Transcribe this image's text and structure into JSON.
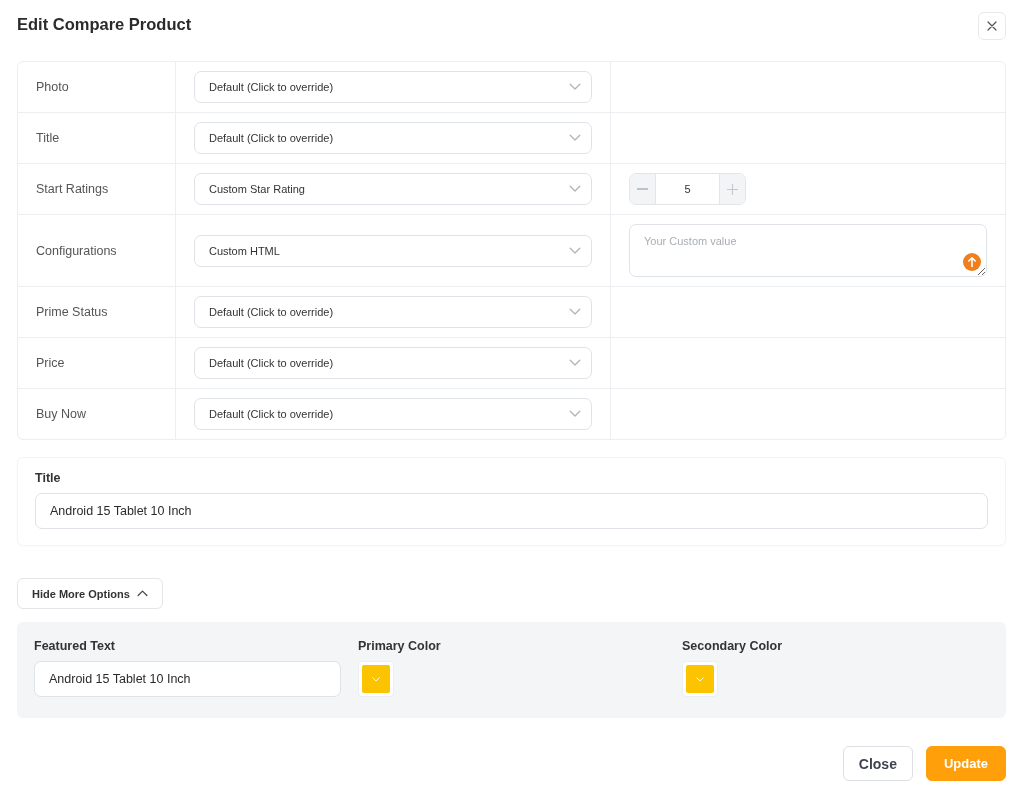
{
  "dialog": {
    "title": "Edit Compare Product"
  },
  "fields": [
    {
      "label": "Photo",
      "select": "Default (Click to override)",
      "kind": "none"
    },
    {
      "label": "Title",
      "select": "Default (Click to override)",
      "kind": "none"
    },
    {
      "label": "Start Ratings",
      "select": "Custom Star Rating",
      "kind": "stepper",
      "value": "5"
    },
    {
      "label": "Configurations",
      "select": "Custom HTML",
      "kind": "textarea",
      "placeholder": "Your Custom value"
    },
    {
      "label": "Prime Status",
      "select": "Default (Click to override)",
      "kind": "none"
    },
    {
      "label": "Price",
      "select": "Default (Click to override)",
      "kind": "none"
    },
    {
      "label": "Buy Now",
      "select": "Default (Click to override)",
      "kind": "none"
    }
  ],
  "title_field": {
    "label": "Title",
    "value": "Android 15 Tablet 10 Inch"
  },
  "options_toggle": {
    "label": "Hide More Options",
    "expanded": true
  },
  "more_options": {
    "featured_text": {
      "label": "Featured Text",
      "value": "Android 15 Tablet 10 Inch"
    },
    "colors": [
      {
        "label": "Primary Color",
        "color": "#fcc400"
      },
      {
        "label": "Secondary Color",
        "color": "#fcc400"
      }
    ]
  },
  "buttons": [
    {
      "label": "Close",
      "kind": "secondary"
    },
    {
      "label": "Update",
      "kind": "primary"
    }
  ]
}
